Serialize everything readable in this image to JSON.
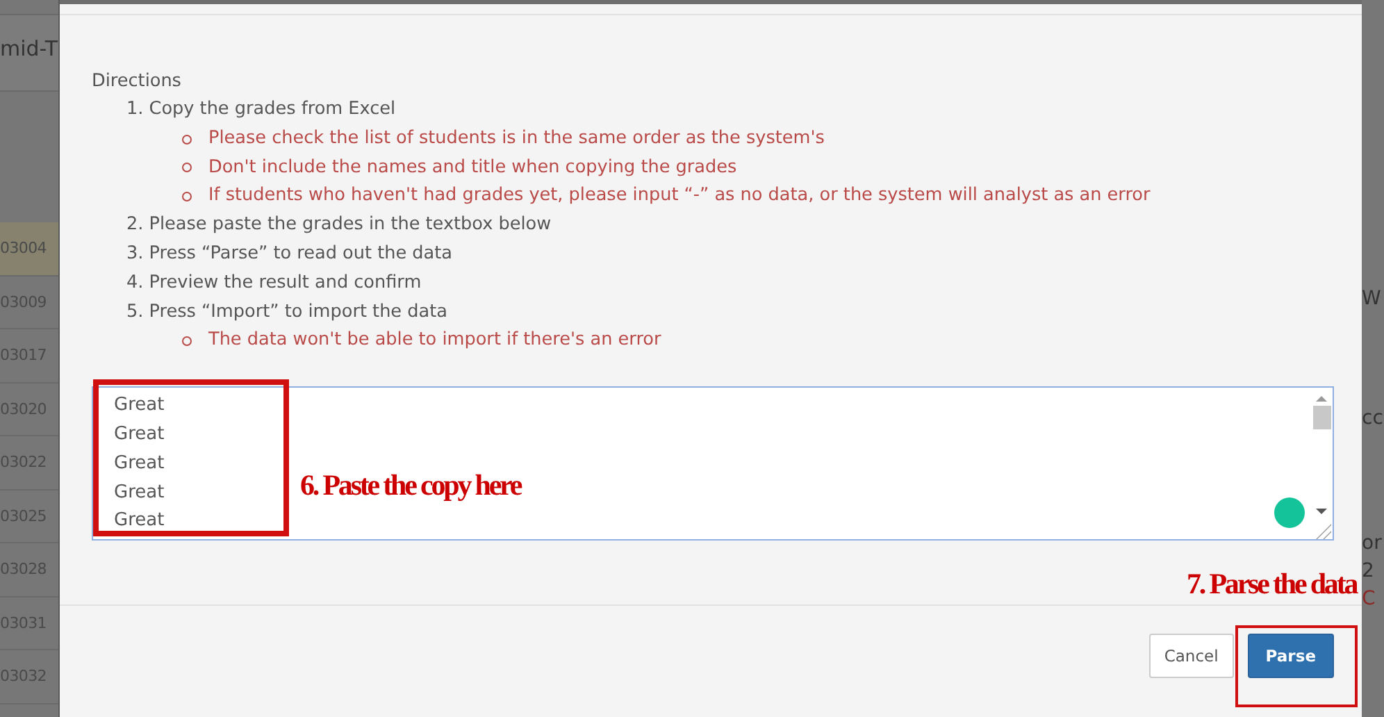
{
  "background": {
    "left_header": "mid-T",
    "left_rows": [
      {
        "id": "03004",
        "selected": true
      },
      {
        "id": "03009",
        "selected": false
      },
      {
        "id": "03017",
        "selected": false
      },
      {
        "id": "03020",
        "selected": false
      },
      {
        "id": "03022",
        "selected": false
      },
      {
        "id": "03025",
        "selected": false
      },
      {
        "id": "03028",
        "selected": false
      },
      {
        "id": "03031",
        "selected": false
      },
      {
        "id": "03032",
        "selected": false
      }
    ],
    "right_fragments": [
      {
        "text": "W",
        "kind": "plain"
      },
      {
        "text": "cc",
        "kind": "plain"
      },
      {
        "text": "or",
        "kind": "plain"
      },
      {
        "text": "2",
        "kind": "plain"
      },
      {
        "text": "C",
        "kind": "alert"
      }
    ]
  },
  "dialog": {
    "directions_title": "Directions",
    "steps": [
      {
        "text": "1. Copy the grades from Excel",
        "notes": [
          "Please check the list of students is in the same order as the system's",
          "Don't include the names and title when copying the grades",
          "If students who haven't had grades yet, please input  “-”  as no data, or the system will analyst as an error"
        ]
      },
      {
        "text": "2. Please paste the grades in the textbox below"
      },
      {
        "text": "3. Press  “Parse”  to read out the data"
      },
      {
        "text": "4. Preview the result and confirm"
      },
      {
        "text": "5. Press  “Import”  to import the data",
        "notes": [
          "The data won't be able to import if there's an error"
        ]
      }
    ],
    "textbox_lines": [
      "Great",
      "Great",
      "Great",
      "Great",
      "Great"
    ],
    "buttons": [
      {
        "label": "Cancel",
        "kind": "default"
      },
      {
        "label": "Parse",
        "kind": "primary"
      }
    ]
  },
  "annotations": [
    {
      "text": "6. Paste  the copy here",
      "kind": "textbox"
    },
    {
      "text": "7. Parse the data",
      "kind": "button"
    }
  ]
}
